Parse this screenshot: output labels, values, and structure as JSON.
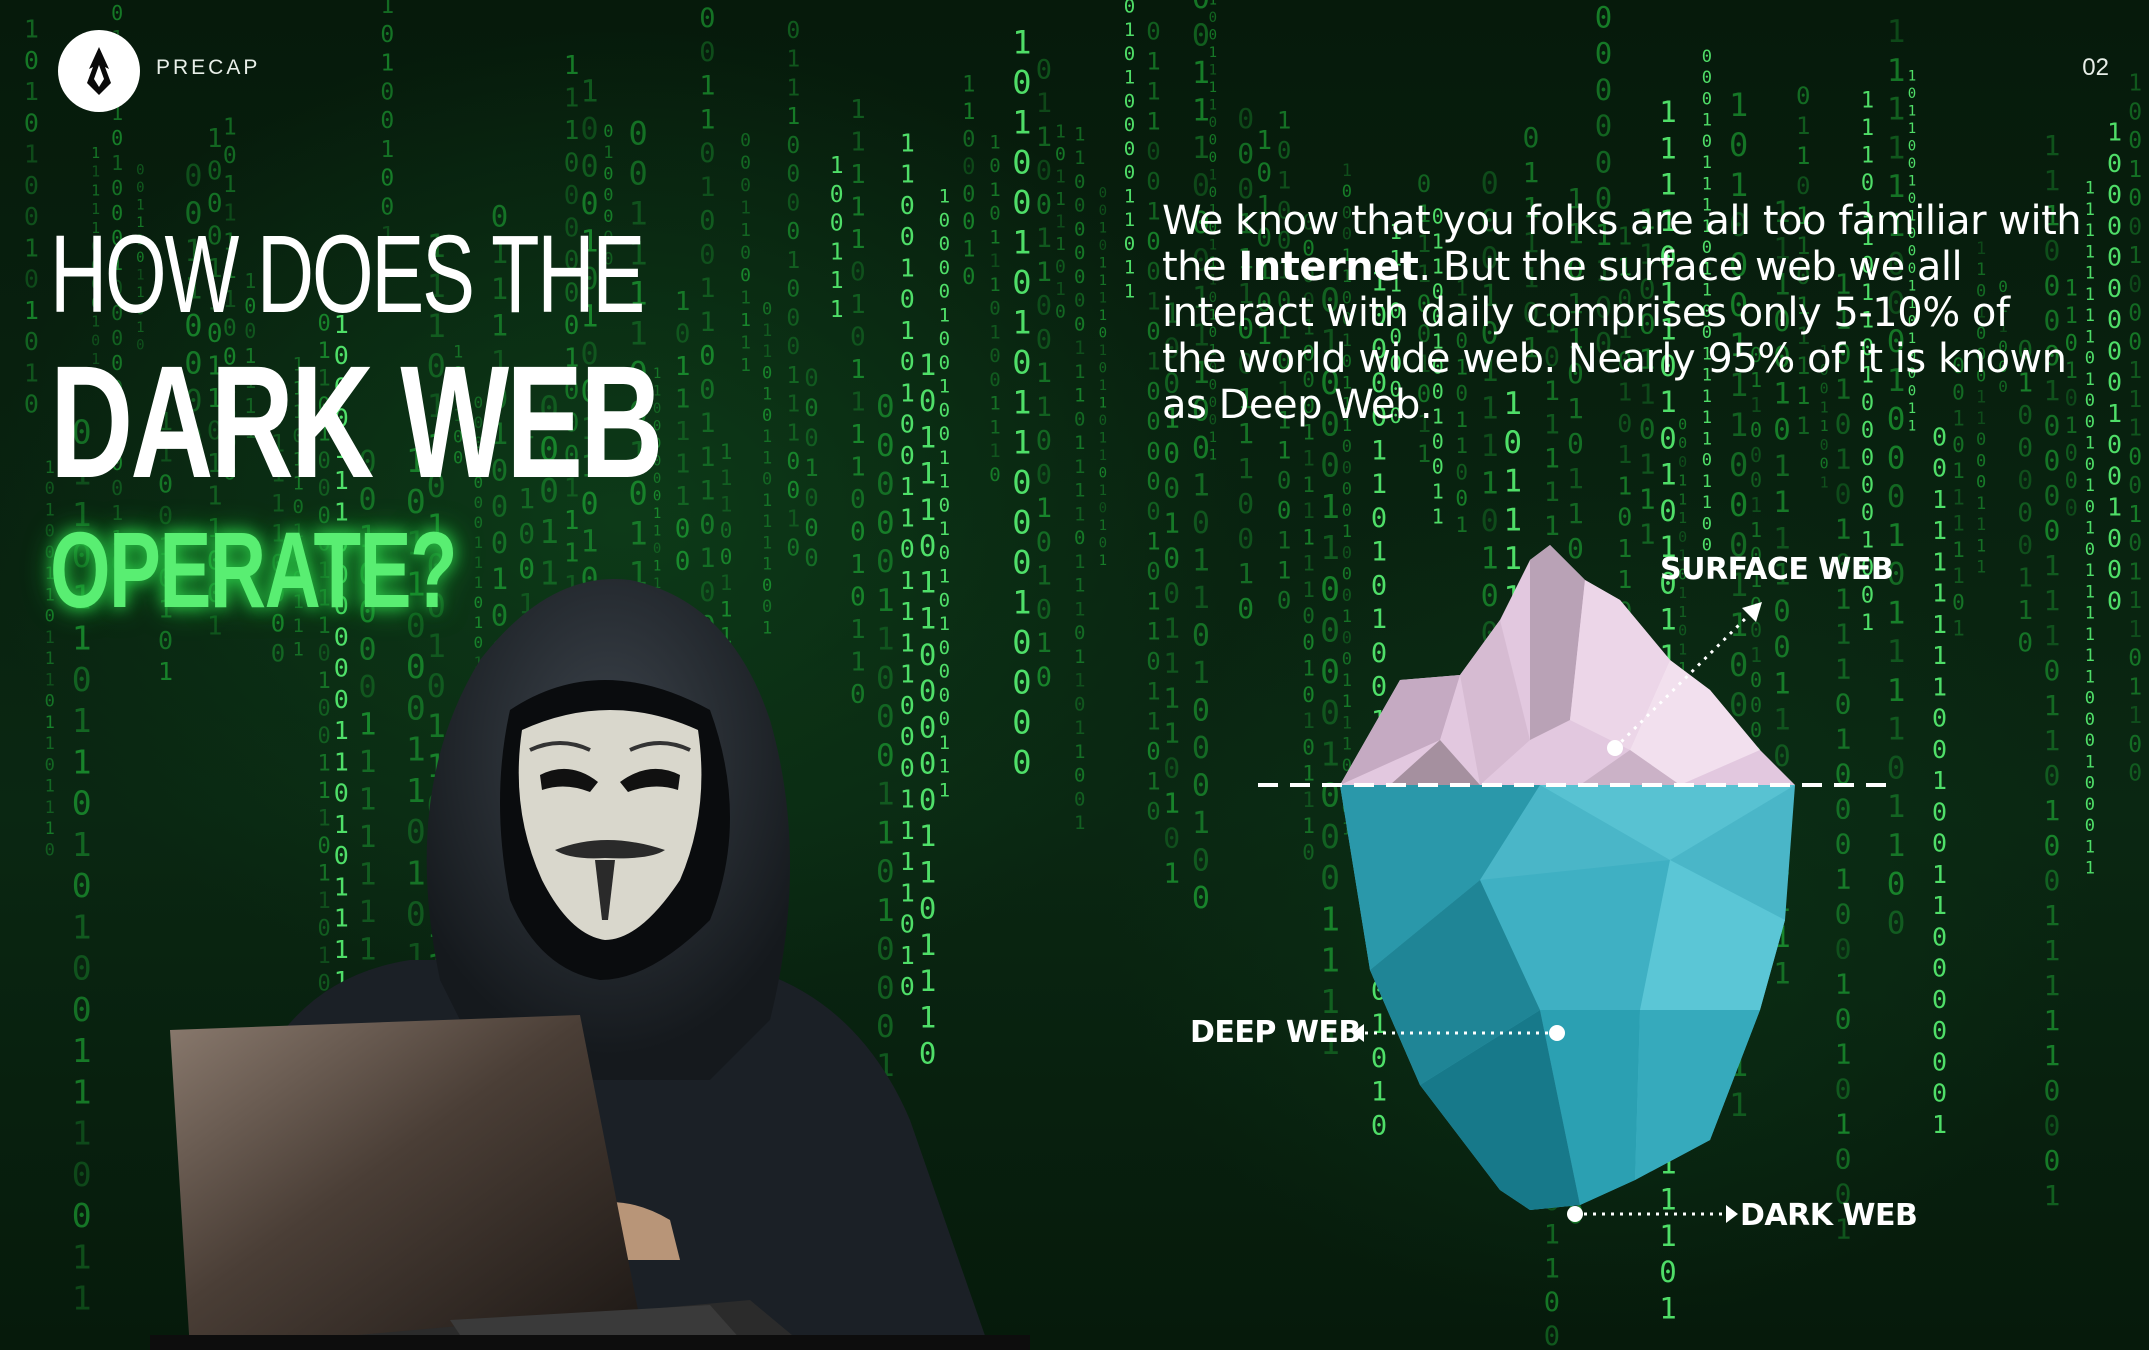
{
  "brand": {
    "name": "PRECAP",
    "logo_icon": "flame-drop-icon"
  },
  "page": {
    "number": "02"
  },
  "headline": {
    "line1": "HOW DOES THE",
    "line2": "DARK WEB",
    "line3": "OPERATE?"
  },
  "intro": {
    "part1": "We know that you folks are all too familiar with the ",
    "bold": "Internet",
    "part2": ". But the surface web we all interact with daily comprises only 5-10% of the world wide web. Nearly 95% of it is known as Deep Web."
  },
  "iceberg": {
    "surface_label": "SURFACE WEB",
    "deep_label": "DEEP WEB",
    "dark_label": "DARK WEB"
  },
  "colors": {
    "background": "#071a0c",
    "matrix_green": "#22c23c",
    "accent_green": "#59ee72",
    "iceberg_top": "#e2c2dc",
    "iceberg_bottom": "#3aaebf"
  }
}
